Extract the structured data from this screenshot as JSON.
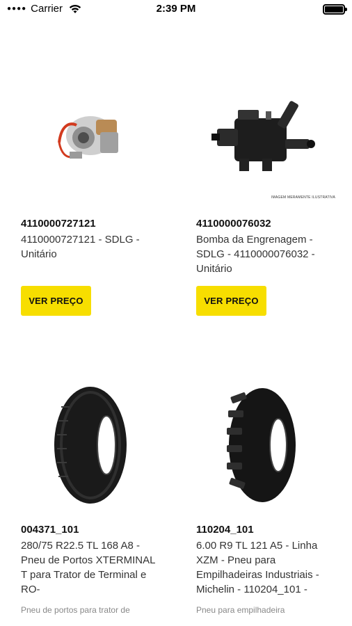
{
  "status_bar": {
    "carrier": "Carrier",
    "time": "2:39 PM"
  },
  "products": [
    {
      "sku": "4110000727121",
      "name": "4110000727121 - SDLG - Unitário",
      "button": "VER PREÇO",
      "image": "turbocharger-image"
    },
    {
      "sku": "4110000076032",
      "name": "Bomba da Engrenagem - SDLG - 4110000076032 - Unitário",
      "button": "VER PREÇO",
      "image": "gear-pump-image",
      "disclaimer": "IMAGEM MERAMENTE ILUSTRATIVA"
    },
    {
      "sku": "004371_101",
      "name": "280/75 R22.5 TL 168 A8 - Pneu de Portos XTERMINAL T para Trator de Terminal e RO-",
      "subtitle": "Pneu de portos para trator de",
      "image": "port-tire-image"
    },
    {
      "sku": "110204_101",
      "name": "6.00 R9 TL 121 A5  - Linha XZM - Pneu para Empilhadeiras Industriais - Michelin - 110204_101 -",
      "subtitle": "Pneu para empilhadeira",
      "image": "forklift-tire-image"
    }
  ],
  "colors": {
    "button_bg": "#f7de00",
    "text": "#111111",
    "muted": "#888888"
  }
}
